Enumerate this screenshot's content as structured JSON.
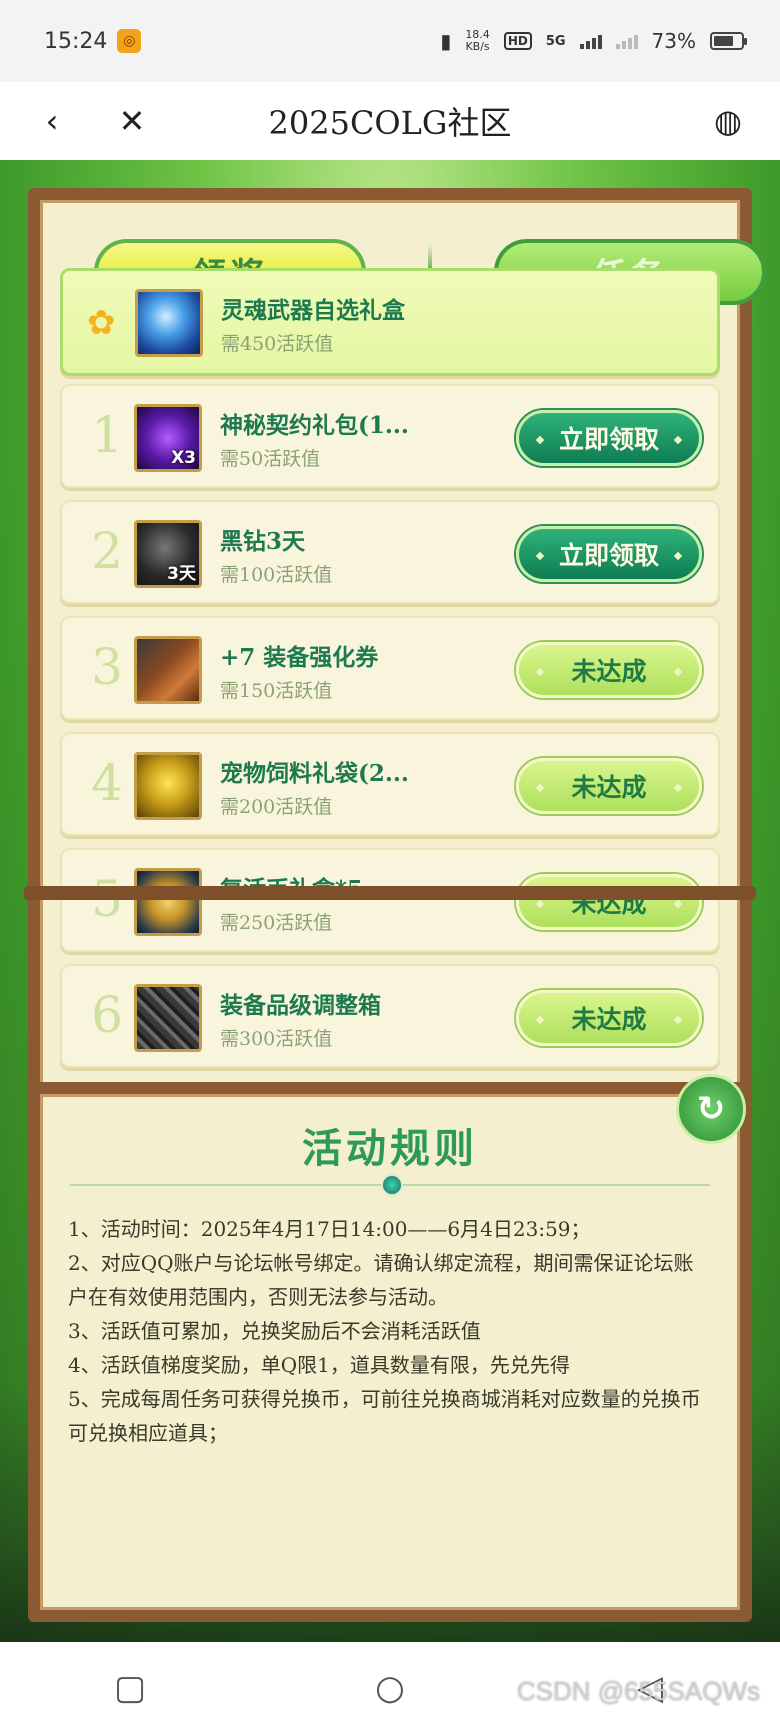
{
  "status": {
    "time": "15:24",
    "speed_top": "18.4",
    "speed_unit": "KB/s",
    "hd": "HD",
    "net": "5G",
    "battery": "73%",
    "battery_level": 0.73
  },
  "nav": {
    "title": "2025COLG社区"
  },
  "tabs": [
    {
      "label": "领奖"
    },
    {
      "label": "任务"
    }
  ],
  "rewards": {
    "featured": {
      "name": "灵魂武器自选礼盒",
      "req": "需450活跃值"
    },
    "items": [
      {
        "num": "1",
        "name": "神秘契约礼包(1...",
        "req": "需50活跃值",
        "qty": "X3",
        "button": "立即领取"
      },
      {
        "num": "2",
        "name": "黑钻3天",
        "req": "需100活跃值",
        "qty": "3天",
        "button": "立即领取"
      },
      {
        "num": "3",
        "name": "+7 装备强化券",
        "req": "需150活跃值",
        "qty": "",
        "button": "未达成"
      },
      {
        "num": "4",
        "name": "宠物饲料礼袋(2...",
        "req": "需200活跃值",
        "qty": "",
        "button": "未达成"
      },
      {
        "num": "5",
        "name": "复活币礼盒*5",
        "req": "需250活跃值",
        "qty": "",
        "button": "未达成"
      },
      {
        "num": "6",
        "name": "装备品级调整箱",
        "req": "需300活跃值",
        "qty": "",
        "button": "未达成"
      }
    ]
  },
  "rules": {
    "title": "活动规则",
    "lines": [
      "1、活动时间：2025年4月17日14:00——6月4日23:59；",
      "2、对应QQ账户与论坛帐号绑定。请确认绑定流程，期间需保证论坛账户在有效使用范围内，否则无法参与活动。",
      "3、活跃值可累加，兑换奖励后不会消耗活跃值",
      "4、活跃值梯度奖励，单Q限1，道具数量有限，先兑先得",
      "5、完成每周任务可获得兑换币，可前往兑换商城消耗对应数量的兑换币可兑换相应道具；"
    ]
  },
  "watermark": "CSDN @655SAQWs",
  "colors": {
    "accent": "#1d7a4e",
    "frame": "#8a5a32",
    "panel": "#f4efcf"
  }
}
